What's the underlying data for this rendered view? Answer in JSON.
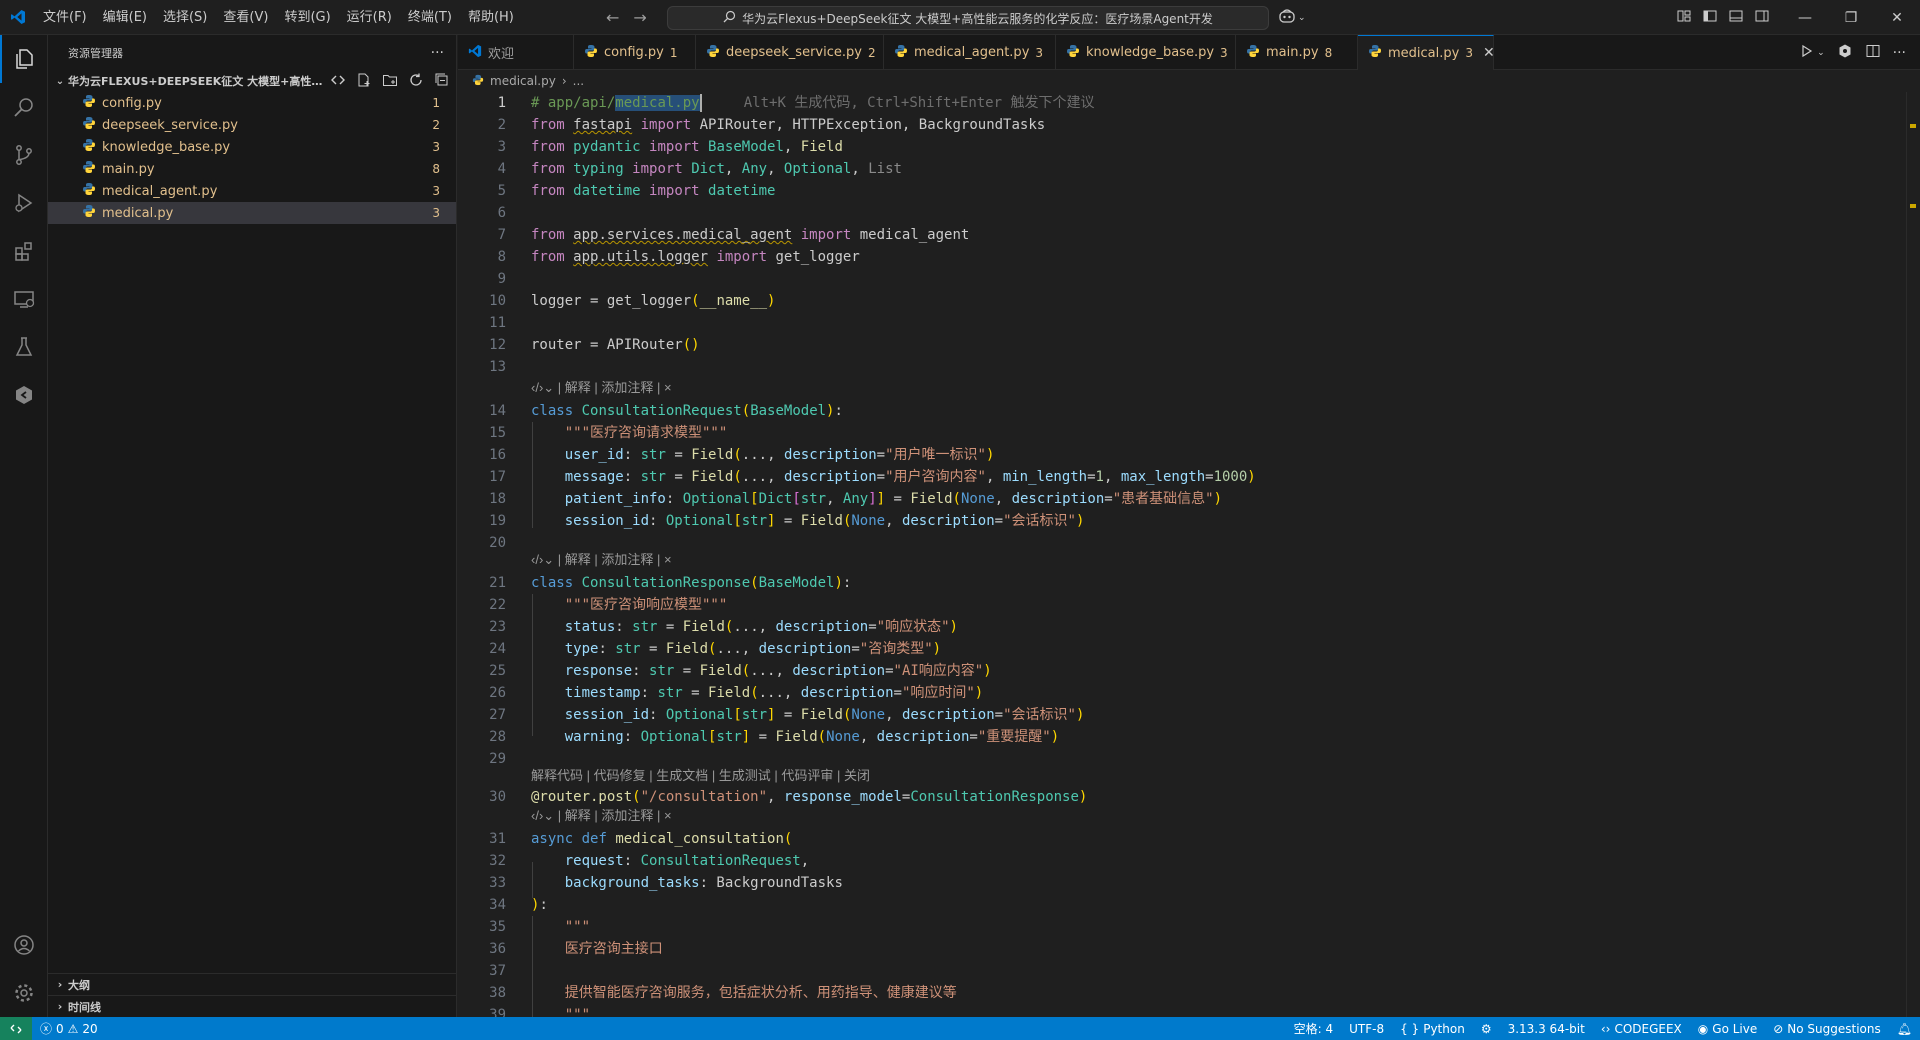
{
  "titlebar": {
    "menu": [
      "文件(F)",
      "编辑(E)",
      "选择(S)",
      "查看(V)",
      "转到(G)",
      "运行(R)",
      "终端(T)",
      "帮助(H)"
    ],
    "search_text": "华为云Flexus+DeepSeek征文 大模型+高性能云服务的化学反应：医疗场景Agent开发"
  },
  "sidebar": {
    "title": "资源管理器",
    "folder": "华为云FLEXUS+DEEPSEEK征文 大模型+高性能云...",
    "files": [
      {
        "name": "config.py",
        "badge": "1"
      },
      {
        "name": "deepseek_service.py",
        "badge": "2"
      },
      {
        "name": "knowledge_base.py",
        "badge": "3"
      },
      {
        "name": "main.py",
        "badge": "8"
      },
      {
        "name": "medical_agent.py",
        "badge": "3"
      },
      {
        "name": "medical.py",
        "badge": "3"
      }
    ],
    "outline_label": "大纲",
    "timeline_label": "时间线"
  },
  "tabs": [
    {
      "name": "欢迎",
      "badge": ""
    },
    {
      "name": "config.py",
      "badge": "1"
    },
    {
      "name": "deepseek_service.py",
      "badge": "2"
    },
    {
      "name": "medical_agent.py",
      "badge": "3"
    },
    {
      "name": "knowledge_base.py",
      "badge": "3"
    },
    {
      "name": "main.py",
      "badge": "8"
    },
    {
      "name": "medical.py",
      "badge": "3"
    }
  ],
  "breadcrumb": {
    "file": "medical.py",
    "rest": "..."
  },
  "editor": {
    "ghost_hint": "Alt+K 生成代码, Ctrl+Shift+Enter 触发下个建议",
    "lens_class": "| 解释 | 添加注释 | ×",
    "lens_func": "解释代码 | 代码修复 | 生成文档 | 生成测试 | 代码评审 | 关闭",
    "line_numbers": [
      "1",
      "2",
      "3",
      "4",
      "5",
      "6",
      "7",
      "8",
      "9",
      "10",
      "11",
      "12",
      "13",
      "14",
      "15",
      "16",
      "17",
      "18",
      "19",
      "20",
      "21",
      "22",
      "23",
      "24",
      "25",
      "26",
      "27",
      "28",
      "29",
      "30",
      "31",
      "32",
      "33",
      "34",
      "35",
      "36",
      "37",
      "38",
      "39"
    ]
  },
  "statusbar": {
    "errors": "0",
    "warnings": "20",
    "spaces": "空格: 4",
    "encoding": "UTF-8",
    "language": "Python",
    "python_version": "3.13.3 64-bit",
    "codegeex": "CODEGEEX",
    "golive": "Go Live",
    "suggestions": "No Suggestions"
  },
  "colors": {
    "accent": "#007acc",
    "modified_file": "#e2c08d",
    "keyword": "#c586c0",
    "string": "#ce9178",
    "class": "#4ec9b0"
  }
}
